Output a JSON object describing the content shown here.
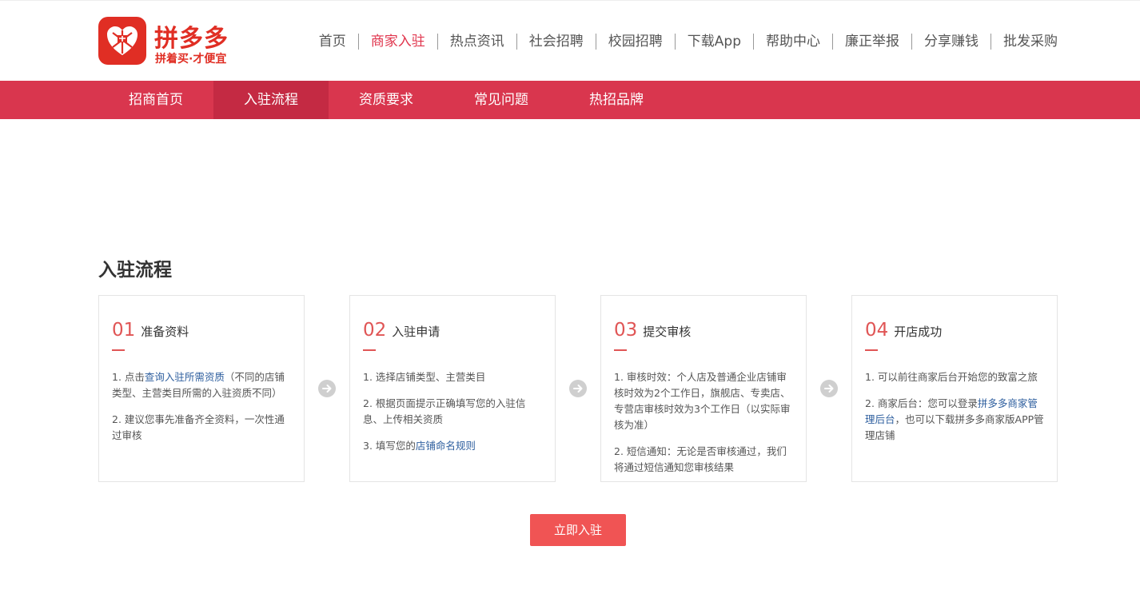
{
  "brand": {
    "name": "拼多多",
    "slogan": "拼着买·才便宜",
    "color": "#e02e24"
  },
  "top_nav": {
    "items": [
      {
        "label": "首页",
        "active": false
      },
      {
        "label": "商家入驻",
        "active": true
      },
      {
        "label": "热点资讯",
        "active": false
      },
      {
        "label": "社会招聘",
        "active": false
      },
      {
        "label": "校园招聘",
        "active": false
      },
      {
        "label": "下载App",
        "active": false
      },
      {
        "label": "帮助中心",
        "active": false
      },
      {
        "label": "廉正举报",
        "active": false
      },
      {
        "label": "分享赚钱",
        "active": false
      },
      {
        "label": "批发采购",
        "active": false
      }
    ],
    "active_color": "#e0344c"
  },
  "sub_nav": {
    "background": "#d9364e",
    "items": [
      {
        "label": "招商首页",
        "active": false
      },
      {
        "label": "入驻流程",
        "active": true
      },
      {
        "label": "资质要求",
        "active": false
      },
      {
        "label": "常见问题",
        "active": false
      },
      {
        "label": "热招品牌",
        "active": false
      }
    ]
  },
  "section": {
    "title": "入驻流程"
  },
  "steps": [
    {
      "num": "01",
      "title": "准备资料",
      "lines": [
        {
          "pre": "1. 点击",
          "link": "查询入驻所需资质",
          "post": "（不同的店铺类型、主营类目所需的入驻资质不同）"
        },
        {
          "pre": "2. 建议您事先准备齐全资料，一次性通过审核",
          "link": "",
          "post": ""
        }
      ]
    },
    {
      "num": "02",
      "title": "入驻申请",
      "lines": [
        {
          "pre": "1. 选择店铺类型、主营类目",
          "link": "",
          "post": ""
        },
        {
          "pre": "2. 根据页面提示正确填写您的入驻信息、上传相关资质",
          "link": "",
          "post": ""
        },
        {
          "pre": "3. 填写您的",
          "link": "店铺命名规则",
          "post": ""
        }
      ]
    },
    {
      "num": "03",
      "title": "提交审核",
      "lines": [
        {
          "pre": "1. 审核时效：个人店及普通企业店铺审核时效为2个工作日，旗舰店、专卖店、专营店审核时效为3个工作日（以实际审核为准）",
          "link": "",
          "post": ""
        },
        {
          "pre": "2. 短信通知：无论是否审核通过，我们将通过短信通知您审核结果",
          "link": "",
          "post": ""
        }
      ]
    },
    {
      "num": "04",
      "title": "开店成功",
      "lines": [
        {
          "pre": "1. 可以前往商家后台开始您的致富之旅",
          "link": "",
          "post": ""
        },
        {
          "pre": "2. 商家后台：您可以登录",
          "link": "拼多多商家管理后台",
          "post": "，也可以下载拼多多商家版APP管理店铺"
        }
      ]
    }
  ],
  "cta": {
    "label": "立即入驻",
    "color": "#f05454"
  },
  "icons": {
    "logo": "pinduoduo-logo-icon",
    "arrow": "arrow-right-circle-icon"
  }
}
